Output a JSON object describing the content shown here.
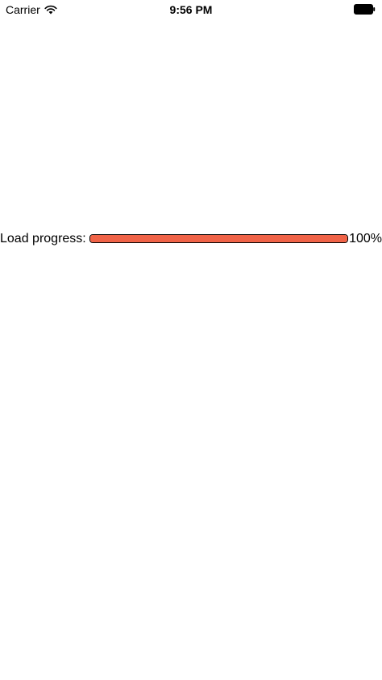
{
  "status_bar": {
    "carrier": "Carrier",
    "time": "9:56 PM",
    "wifi_icon": "wifi-icon",
    "battery_icon": "battery-icon"
  },
  "progress": {
    "label": "Load progress:",
    "value_text": "100%",
    "value": 1.0,
    "fill_color": "#f06347",
    "border_color": "#000000"
  }
}
